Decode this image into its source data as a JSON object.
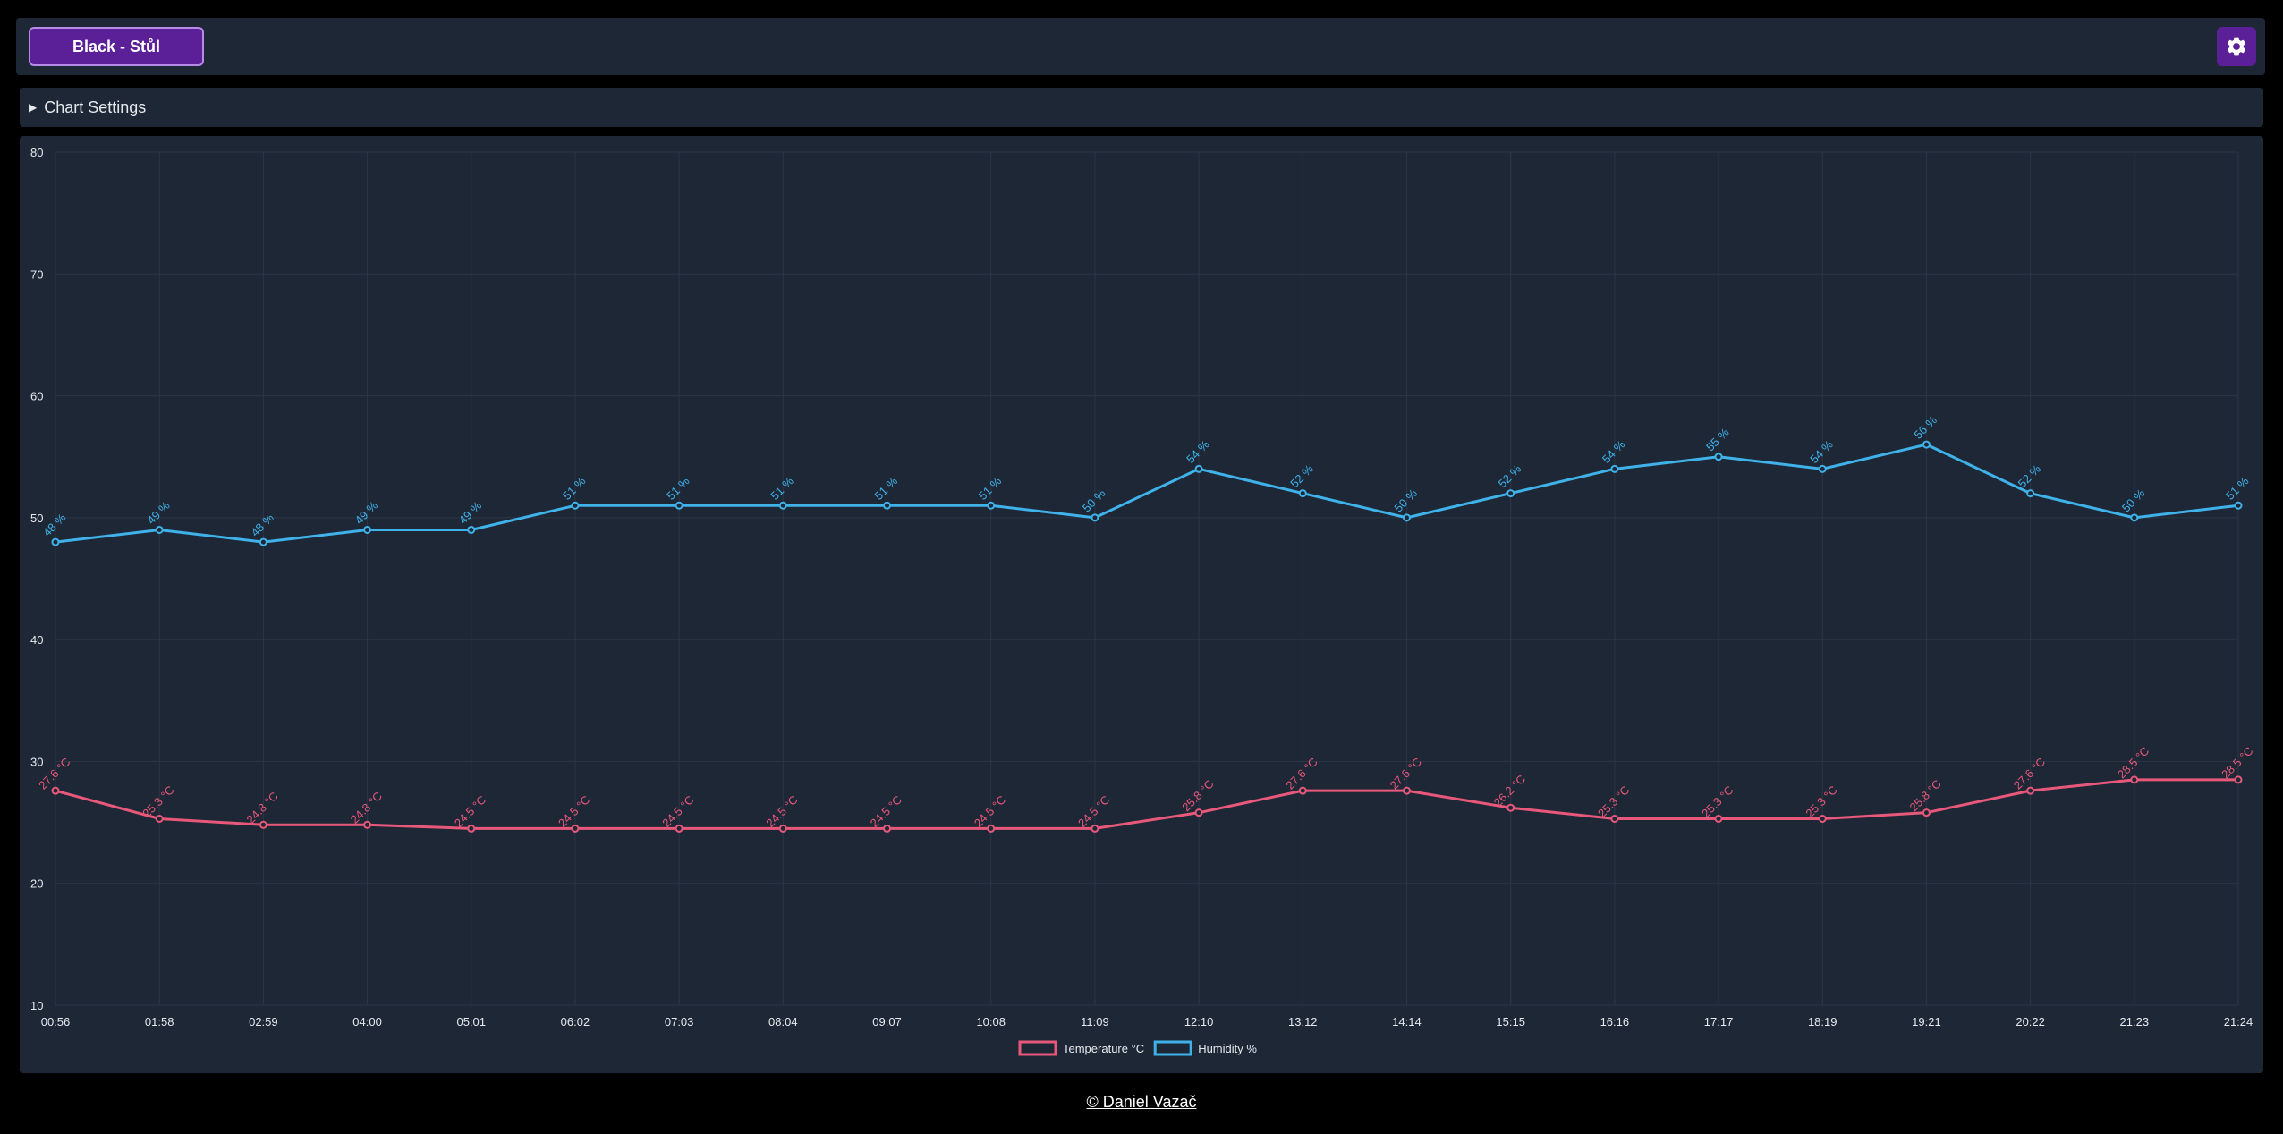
{
  "header": {
    "device_button": "Black - Stůl",
    "settings_icon": "gear-icon"
  },
  "settings": {
    "toggle_icon": "▶",
    "label": "Chart Settings"
  },
  "footer": {
    "text": "© Daniel Vazač"
  },
  "colors": {
    "temperature": "#e8587a",
    "humidity": "#3fb2ea",
    "accent": "#5b1f97",
    "panel": "#1e2735"
  },
  "chart_data": {
    "type": "line",
    "x": [
      "00:56",
      "01:58",
      "02:59",
      "04:00",
      "05:01",
      "06:02",
      "07:03",
      "08:04",
      "09:07",
      "10:08",
      "11:09",
      "12:10",
      "13:12",
      "14:14",
      "15:15",
      "16:16",
      "17:17",
      "18:19",
      "19:21",
      "20:22",
      "21:23",
      "21:24"
    ],
    "ylim": [
      10,
      80
    ],
    "yticks": [
      10,
      20,
      30,
      40,
      50,
      60,
      70,
      80
    ],
    "grid": true,
    "legend": "bottom",
    "series": [
      {
        "name": "Temperature °C",
        "unit": " °C",
        "values": [
          27.6,
          25.3,
          24.8,
          24.8,
          24.5,
          24.5,
          24.5,
          24.5,
          24.5,
          24.5,
          24.5,
          25.8,
          27.6,
          27.6,
          26.2,
          25.3,
          25.3,
          25.3,
          25.8,
          27.6,
          28.5,
          28.5
        ]
      },
      {
        "name": "Humidity %",
        "unit": " %",
        "values": [
          48,
          49,
          48,
          49,
          49,
          51,
          51,
          51,
          51,
          51,
          50,
          54,
          52,
          50,
          52,
          54,
          55,
          54,
          56,
          52,
          50,
          51
        ]
      }
    ]
  }
}
